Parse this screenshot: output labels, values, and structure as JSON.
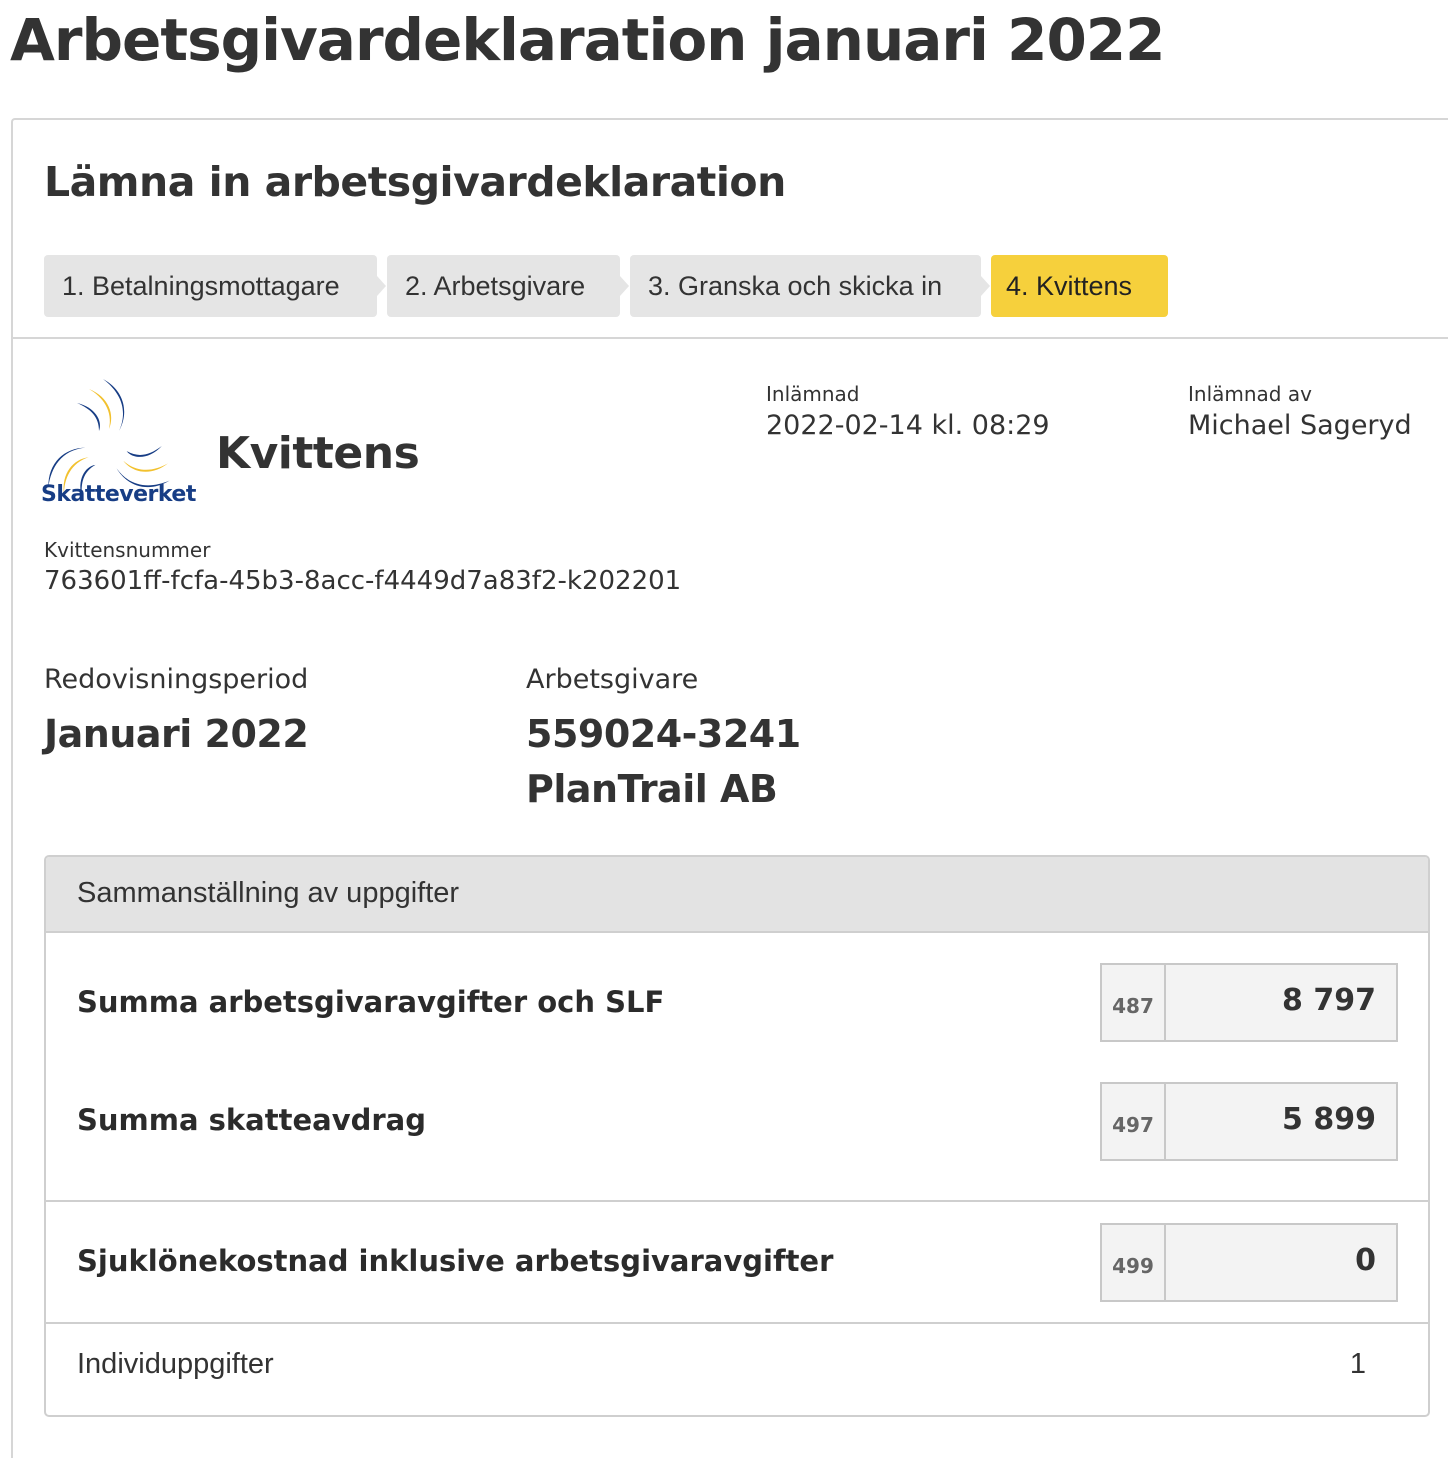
{
  "page": {
    "title": "Arbetsgivardeklaration januari 2022"
  },
  "card": {
    "title": "Lämna in arbetsgivardeklaration",
    "steps": [
      {
        "label": "1. Betalningsmottagare",
        "active": false
      },
      {
        "label": "2. Arbetsgivare",
        "active": false
      },
      {
        "label": "3. Granska och skicka in",
        "active": false
      },
      {
        "label": "4. Kvittens",
        "active": true
      }
    ]
  },
  "receipt": {
    "logo_text": "Skatteverket",
    "heading": "Kvittens",
    "submitted_label": "Inlämnad",
    "submitted_value": "2022-02-14 kl. 08:29",
    "submitted_by_label": "Inlämnad av",
    "submitted_by_value": "Michael Sageryd",
    "receipt_number_label": "Kvittensnummer",
    "receipt_number_value": "763601ff-fcfa-45b3-8acc-f4449d7a83f2-k202201"
  },
  "details": {
    "period_label": "Redovisningsperiod",
    "period_value": "Januari 2022",
    "employer_label": "Arbetsgivare",
    "employer_orgnr": "559024-3241",
    "employer_name": "PlanTrail AB"
  },
  "summary": {
    "title": "Sammanställning av uppgifter",
    "rows": [
      {
        "label": "Summa arbetsgivaravgifter och SLF",
        "code": "487",
        "value": "8 797"
      },
      {
        "label": "Summa skatteavdrag",
        "code": "497",
        "value": "5 899"
      },
      {
        "label": "Sjuklönekostnad inklusive arbetsgivaravgifter",
        "code": "499",
        "value": "0"
      }
    ],
    "individ_label": "Individuppgifter",
    "individ_value": "1"
  },
  "colors": {
    "active_step": "#f6d03c",
    "inactive_step": "#e5e5e5",
    "logo_blue": "#173d85",
    "logo_yellow": "#f2c12e"
  }
}
